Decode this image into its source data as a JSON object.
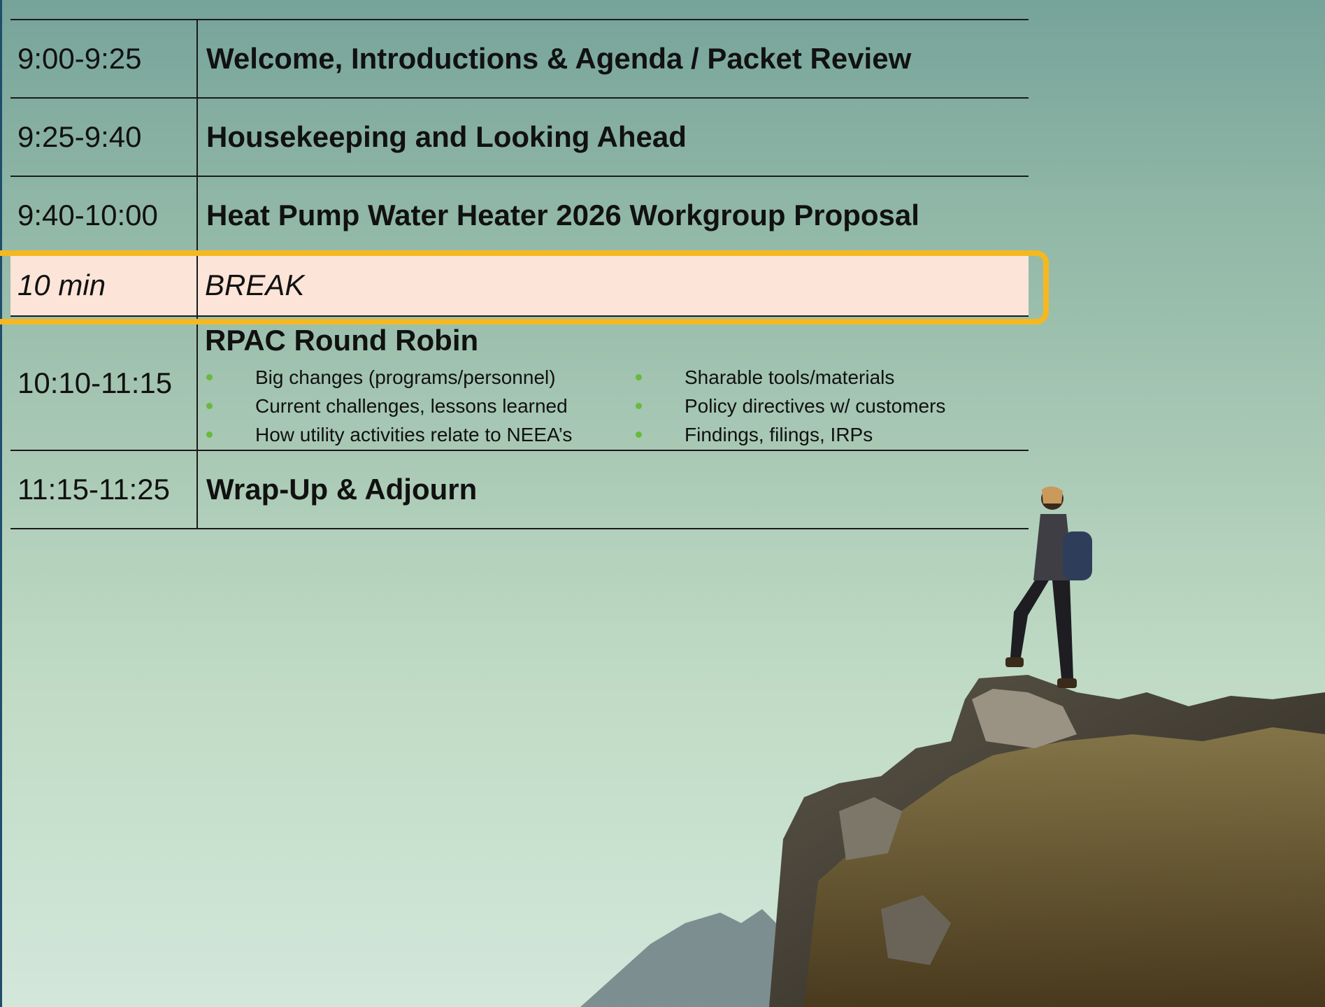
{
  "agenda": {
    "rows": [
      {
        "time": "9:00-9:25",
        "topic": "Welcome, Introductions & Agenda / Packet Review"
      },
      {
        "time": "9:25-9:40",
        "topic": "Housekeeping and Looking Ahead"
      },
      {
        "time": "9:40-10:00",
        "topic": "Heat Pump Water Heater 2026 Workgroup Proposal"
      }
    ],
    "break": {
      "time": "10 min",
      "topic": "BREAK"
    },
    "round_robin": {
      "time": "10:10-11:15",
      "title": "RPAC Round Robin",
      "col1": [
        "Big changes (programs/personnel)",
        "Current challenges, lessons learned",
        "How utility activities relate to NEEA’s"
      ],
      "col2": [
        "Sharable tools/materials",
        "Policy directives w/ customers",
        "Findings, filings, IRPs"
      ]
    },
    "wrap": {
      "time": "11:15-11:25",
      "topic": "Wrap-Up & Adjourn"
    }
  },
  "colors": {
    "break_fill": "#fce4d9",
    "break_outline": "#f5b820",
    "bullet": "#66bb3c"
  }
}
